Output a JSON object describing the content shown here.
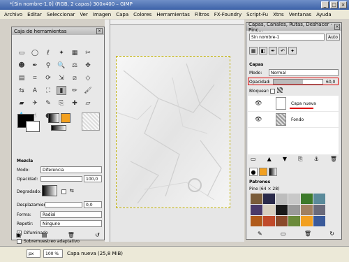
{
  "window": {
    "title": "*[Sin nombre-1.0] (RGB, 2 capas) 300x400 – GIMP"
  },
  "menu": [
    "Archivo",
    "Editar",
    "Seleccionar",
    "Ver",
    "Imagen",
    "Capa",
    "Colores",
    "Herramientas",
    "Filtros",
    "FX-Foundry",
    "Script-Fu",
    "Xtns",
    "Ventanas",
    "Ayuda"
  ],
  "toolbox": {
    "title": "Caja de herramientas",
    "section": "Mezcla",
    "mode_label": "Modo:",
    "mode_value": "Diferencia",
    "opacity_label": "Opacidad:",
    "opacity_value": "100,0",
    "gradient_label": "Degradado:",
    "offset_label": "Desplazamiento:",
    "offset_value": "0,0",
    "shape_label": "Forma:",
    "shape_value": "Radial",
    "repeat_label": "Repetir:",
    "repeat_value": "Ninguno",
    "dither_label": "Difuminado",
    "supersample_label": "Sobremuestreo adaptativo"
  },
  "layers_panel": {
    "title": "Capas, Canales, Rutas, Deshacer - Pinc...",
    "image_select": "Sin nombre-1",
    "auto_button": "Auto",
    "section": "Capas",
    "mode_label": "Modo:",
    "mode_value": "Normal",
    "opacity_label": "Opacidad:",
    "opacity_value": "60,0",
    "lock_label": "Bloquear:",
    "layers": [
      {
        "name": "Capa nueva",
        "selected": true
      },
      {
        "name": "Fondo",
        "selected": false
      }
    ],
    "patterns_section": "Patrones",
    "patterns_caption": "Pine (64 × 28)"
  },
  "status": {
    "unit": "px",
    "zoom": "100 %",
    "text": "Capa nueva (25,8 MiB)"
  }
}
